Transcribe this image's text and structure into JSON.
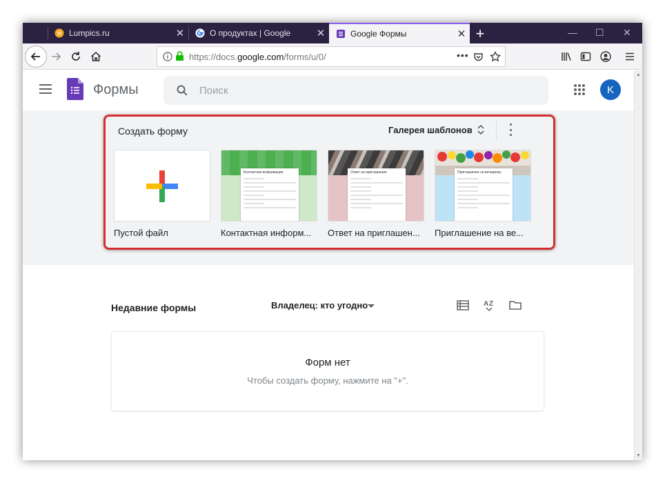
{
  "browser": {
    "tabs": [
      {
        "title": "Lumpics.ru",
        "favicon": "lumpics-favicon"
      },
      {
        "title": "О продуктах | Google",
        "favicon": "google-favicon"
      },
      {
        "title": "Google Формы",
        "favicon": "forms-favicon"
      }
    ],
    "url_prefix": "https://docs.",
    "url_domain": "google.com",
    "url_suffix": "/forms/u/0/"
  },
  "header": {
    "app_name": "Формы",
    "search_placeholder": "Поиск",
    "avatar_letter": "K"
  },
  "templates": {
    "create_label": "Создать форму",
    "gallery_label": "Галерея шаблонов",
    "items": [
      {
        "label": "Пустой файл"
      },
      {
        "label": "Контактная информ...",
        "mini_title": "Контактная информация"
      },
      {
        "label": "Ответ на приглашен...",
        "mini_title": "Ответ на приглашение"
      },
      {
        "label": "Приглашение на ве...",
        "mini_title": "Приглашение на вечеринку"
      }
    ]
  },
  "recent": {
    "title": "Недавние формы",
    "owner_filter": "Владелец: кто угодно",
    "empty_title": "Форм нет",
    "empty_subtitle": "Чтобы создать форму, нажмите на \"+\"."
  },
  "colors": {
    "forms_purple": "#673ab7",
    "highlight_red": "#d32f2f",
    "tab_bar": "#2b2140"
  }
}
